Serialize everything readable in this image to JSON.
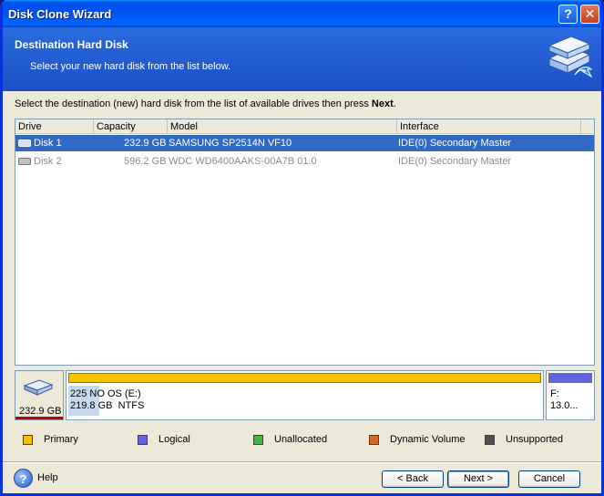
{
  "window": {
    "title": "Disk Clone Wizard"
  },
  "header": {
    "title": "Destination Hard Disk",
    "subtitle": "Select your new hard disk from the list below."
  },
  "instruction": {
    "text": "Select the destination (new) hard disk from the list of available drives then press ",
    "emphasis": "Next",
    "suffix": "."
  },
  "drive_list": {
    "columns": [
      "Drive",
      "Capacity",
      "Model",
      "Interface"
    ],
    "rows": [
      {
        "drive": "Disk 1",
        "capacity": "232.9 GB",
        "model": "SAMSUNG SP2514N VF10",
        "interface": "IDE(0) Secondary Master",
        "selected": true,
        "enabled": true
      },
      {
        "drive": "Disk 2",
        "capacity": "596.2 GB",
        "model": "WDC WD6400AAKS-00A7B 01.0",
        "interface": "IDE(0) Secondary Master",
        "selected": false,
        "enabled": false
      }
    ]
  },
  "disk_map": {
    "disk_size": "232.9 GB",
    "partitions": [
      {
        "line1": "225 NO OS (E:)",
        "line2": "219.8 GB  NTFS",
        "type": "Primary",
        "bar_color": "#f5c200"
      },
      {
        "line1": "F:",
        "line2": "13.0...",
        "type": "Logical",
        "bar_color": "#6464dc"
      }
    ]
  },
  "legend": [
    {
      "label": "Primary",
      "mnemonic": "P",
      "color": "#f5c200"
    },
    {
      "label": "Logical",
      "mnemonic": "L",
      "color": "#6464dc"
    },
    {
      "label": "Unallocated",
      "mnemonic": "U",
      "color": "#44b444"
    },
    {
      "label": "Dynamic Volume",
      "mnemonic": "D",
      "color": "#d2692d"
    },
    {
      "label": "Unsupported",
      "mnemonic": "U",
      "color": "#505050"
    }
  ],
  "footer": {
    "help": {
      "label": "Help",
      "mnemonic": "H"
    },
    "back": {
      "label": "< Back",
      "mnemonic": "B"
    },
    "next": {
      "label": "Next >",
      "mnemonic": "N"
    },
    "cancel": {
      "label": "Cancel",
      "mnemonic": "C"
    }
  }
}
